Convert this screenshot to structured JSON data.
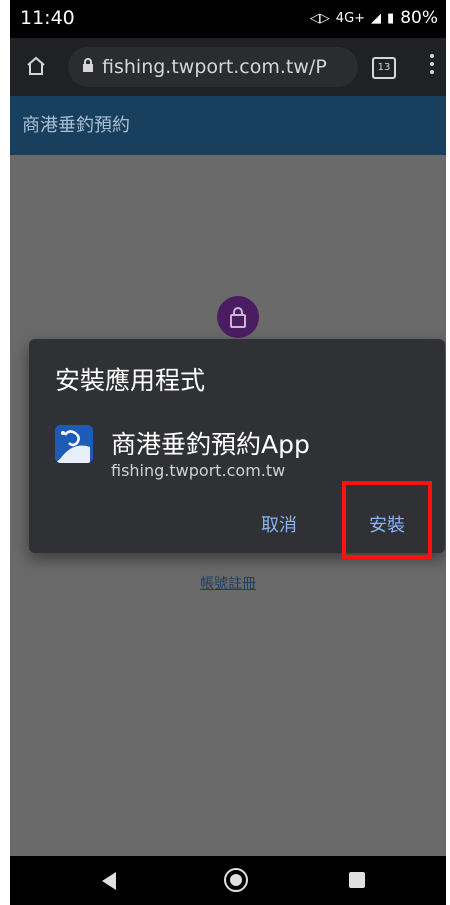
{
  "status_bar": {
    "time": "11:40",
    "network": "4G+",
    "battery": "80%"
  },
  "browser": {
    "url": "fishing.twport.com.tw/P",
    "tab_count": "13"
  },
  "page": {
    "header_title": "商港垂釣預約",
    "register_link": "帳號註冊"
  },
  "dialog": {
    "title": "安裝應用程式",
    "app_name": "商港垂釣預約App",
    "app_url": "fishing.twport.com.tw",
    "cancel_label": "取消",
    "install_label": "安裝"
  },
  "icons": {
    "home": "home-icon",
    "lock": "lock-icon",
    "menu": "menu-icon",
    "app": "app-icon",
    "back": "back-icon",
    "home_nav": "home-nav-icon",
    "recent": "recent-apps-icon"
  },
  "colors": {
    "header_bg": "#193f5f",
    "dialog_bg": "#303134",
    "accent_link": "#8ab4f8",
    "highlight": "#ff1111"
  }
}
